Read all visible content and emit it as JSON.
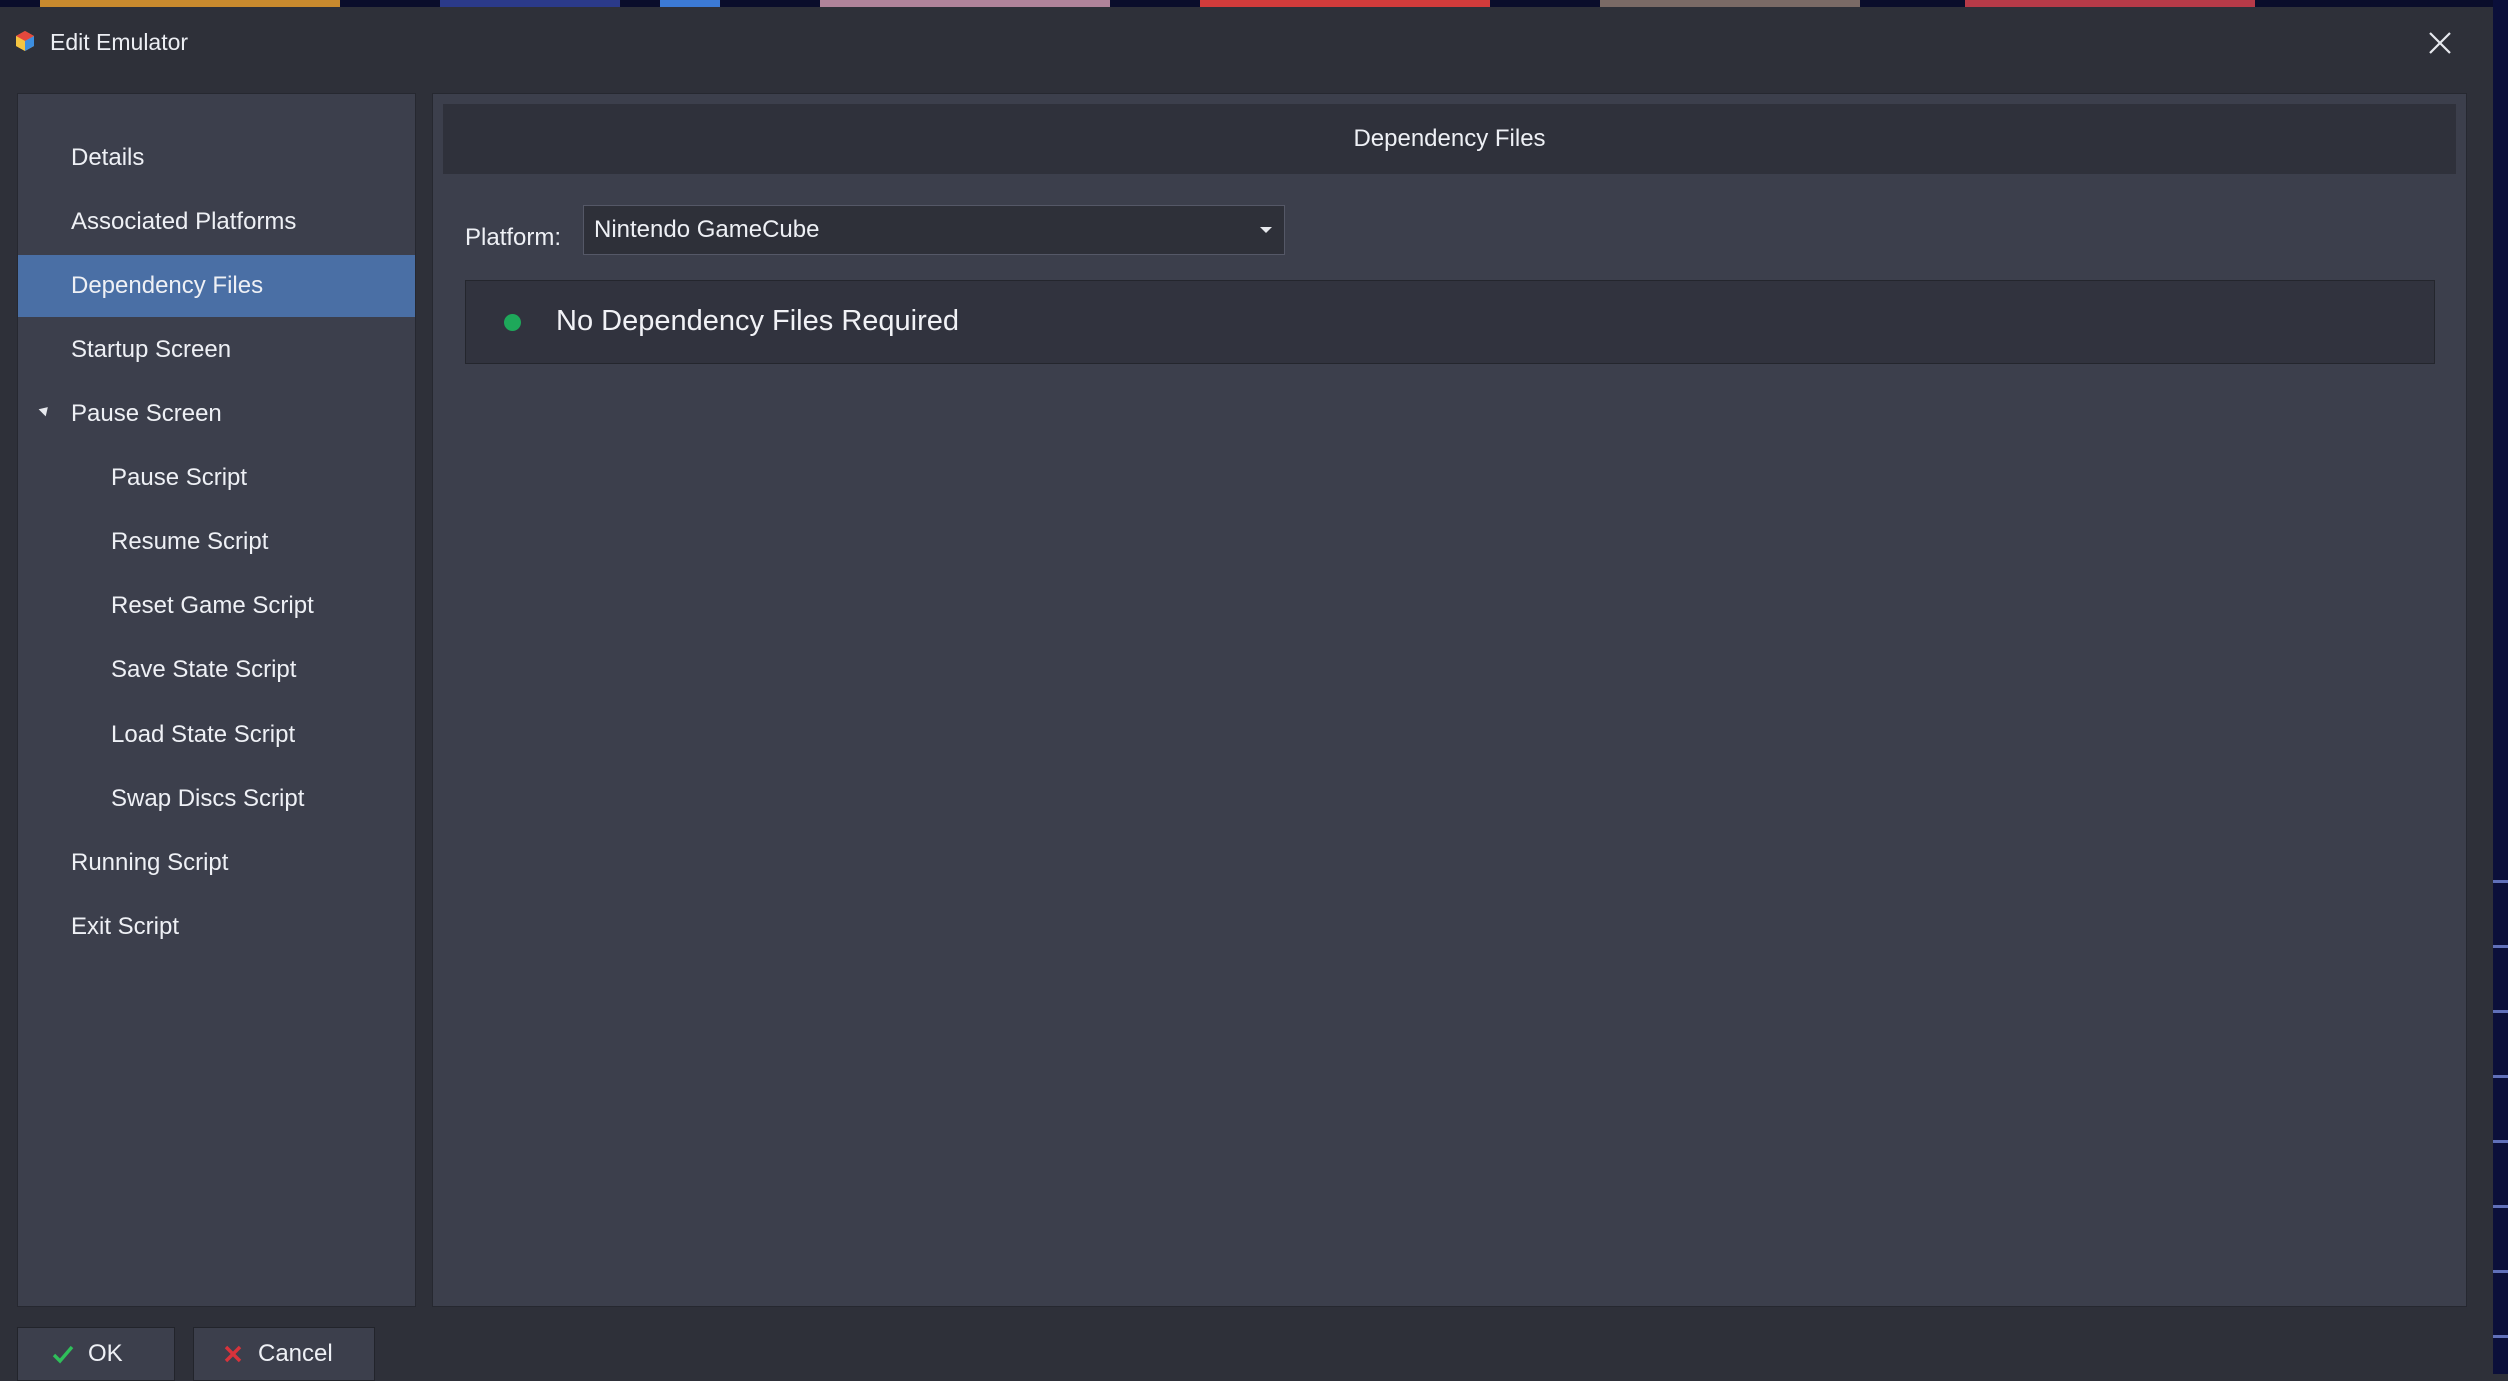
{
  "window": {
    "title": "Edit Emulator",
    "close_icon": "close-icon"
  },
  "sidebar": {
    "items": [
      {
        "label": "Details",
        "selected": false,
        "level": 0
      },
      {
        "label": "Associated Platforms",
        "selected": false,
        "level": 0
      },
      {
        "label": "Dependency Files",
        "selected": true,
        "level": 0
      },
      {
        "label": "Startup Screen",
        "selected": false,
        "level": 0
      },
      {
        "label": "Pause Screen",
        "selected": false,
        "level": 0,
        "expanded": true
      },
      {
        "label": "Pause Script",
        "selected": false,
        "level": 1
      },
      {
        "label": "Resume Script",
        "selected": false,
        "level": 1
      },
      {
        "label": "Reset Game Script",
        "selected": false,
        "level": 1
      },
      {
        "label": "Save State Script",
        "selected": false,
        "level": 1
      },
      {
        "label": "Load State Script",
        "selected": false,
        "level": 1
      },
      {
        "label": "Swap Discs Script",
        "selected": false,
        "level": 1
      },
      {
        "label": "Running Script",
        "selected": false,
        "level": 0
      },
      {
        "label": "Exit Script",
        "selected": false,
        "level": 0
      }
    ]
  },
  "content": {
    "header": "Dependency Files",
    "platform_label": "Platform:",
    "platform_value": "Nintendo GameCube",
    "status_text": "No Dependency Files Required",
    "status_color": "#1ea85a"
  },
  "buttons": {
    "ok_label": "OK",
    "cancel_label": "Cancel"
  },
  "colors": {
    "selected_item": "#4a6fa5",
    "background": "#2e3039",
    "panel": "#3c3f4c"
  }
}
